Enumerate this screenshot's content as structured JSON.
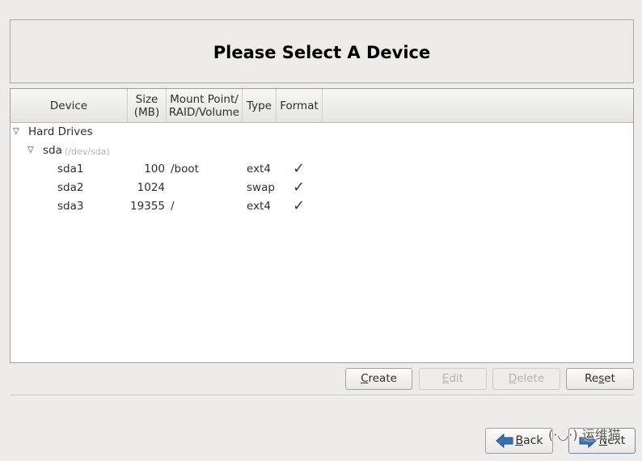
{
  "header": {
    "title": "Please Select A Device"
  },
  "table": {
    "columns": [
      {
        "label": "Device"
      },
      {
        "label_line1": "Size",
        "label_line2": "(MB)"
      },
      {
        "label_line1": "Mount Point/",
        "label_line2": "RAID/Volume"
      },
      {
        "label": "Type"
      },
      {
        "label": "Format"
      }
    ],
    "group": {
      "label": "Hard Drives",
      "expander": "▽"
    },
    "disk": {
      "name": "sda",
      "path": "(/dev/sda)",
      "expander": "▽"
    },
    "partitions": [
      {
        "device": "sda1",
        "size": "100",
        "mount": "/boot",
        "type": "ext4",
        "format": "✓"
      },
      {
        "device": "sda2",
        "size": "1024",
        "mount": "",
        "type": "swap",
        "format": "✓"
      },
      {
        "device": "sda3",
        "size": "19355",
        "mount": "/",
        "type": "ext4",
        "format": "✓"
      }
    ]
  },
  "actions": {
    "create": {
      "accel": "C",
      "rest": "reate"
    },
    "edit": {
      "accel": "E",
      "rest": "dit"
    },
    "delete": {
      "accel": "D",
      "rest": "elete"
    },
    "reset": {
      "pre": "Re",
      "accel": "s",
      "rest": "et"
    }
  },
  "nav": {
    "back": {
      "accel": "B",
      "rest": "ack"
    },
    "next": {
      "accel": "N",
      "rest": "ext"
    }
  },
  "watermark": {
    "text": "(·◡·) 运维猫"
  },
  "colors": {
    "arrow": "#3a6fb5",
    "check": "#2a3a5a"
  }
}
